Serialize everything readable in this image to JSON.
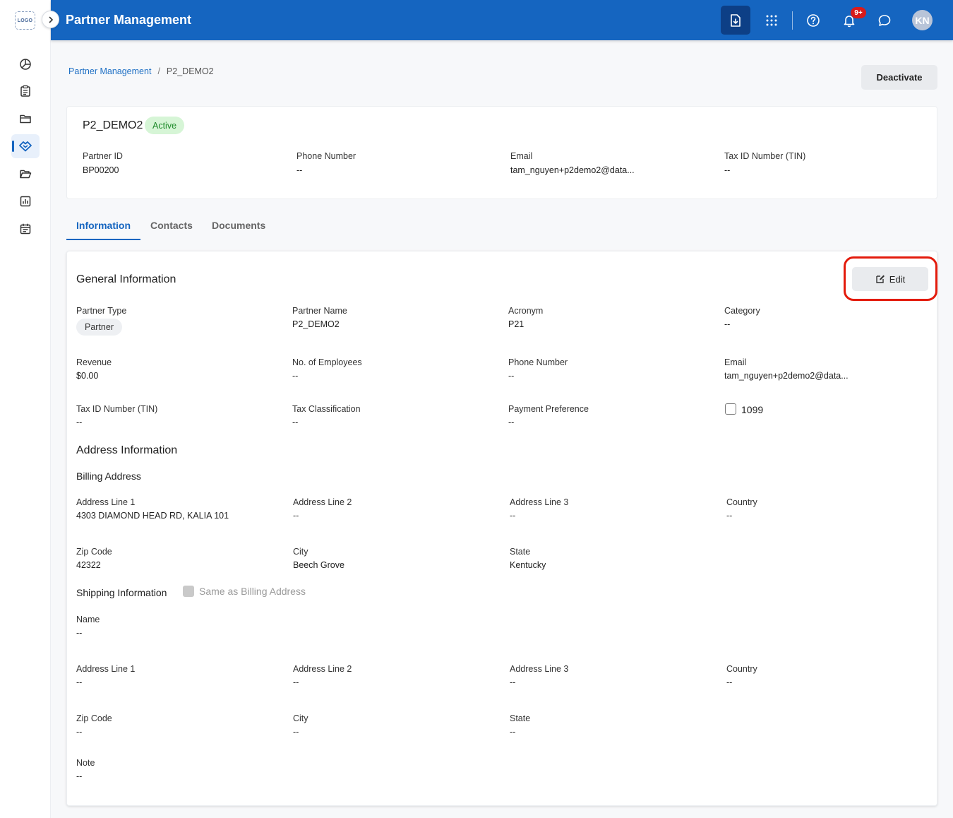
{
  "sidebar": {
    "logo_text": "LOGO",
    "items": [
      {
        "name": "dashboard",
        "icon": "pie-chart-icon"
      },
      {
        "name": "reports",
        "icon": "clipboard-icon"
      },
      {
        "name": "folder",
        "icon": "folder-icon"
      },
      {
        "name": "partners",
        "icon": "handshake-icon",
        "active": true
      },
      {
        "name": "folder-open",
        "icon": "folder-open-icon"
      },
      {
        "name": "analytics",
        "icon": "bar-chart-icon"
      },
      {
        "name": "calendar",
        "icon": "calendar-icon"
      }
    ]
  },
  "header": {
    "title": "Partner Management",
    "notification_count": "9+",
    "avatar_initials": "KN",
    "accent_color": "#1565c0"
  },
  "breadcrumb": {
    "parent": "Partner Management",
    "separator": "/",
    "current": "P2_DEMO2"
  },
  "actions": {
    "deactivate_label": "Deactivate",
    "edit_label": "Edit"
  },
  "summary": {
    "name": "P2_DEMO2",
    "status": "Active",
    "fields": [
      {
        "label": "Partner ID",
        "value": "BP00200"
      },
      {
        "label": "Phone Number",
        "value": "--"
      },
      {
        "label": "Email",
        "value": "tam_nguyen+p2demo2@data..."
      },
      {
        "label": "Tax ID Number (TIN)",
        "value": "--"
      }
    ]
  },
  "tabs": [
    {
      "label": "Information",
      "active": true
    },
    {
      "label": "Contacts"
    },
    {
      "label": "Documents"
    }
  ],
  "general": {
    "title": "General Information",
    "partner_type": {
      "label": "Partner Type",
      "value": "Partner"
    },
    "row1": [
      {
        "label": "Partner Name",
        "value": "P2_DEMO2"
      },
      {
        "label": "Acronym",
        "value": "P21"
      },
      {
        "label": "Category",
        "value": "--"
      }
    ],
    "row2": [
      {
        "label": "Revenue",
        "value": "$0.00"
      },
      {
        "label": "No. of Employees",
        "value": "--"
      },
      {
        "label": "Phone Number",
        "value": "--"
      },
      {
        "label": "Email",
        "value": "tam_nguyen+p2demo2@data..."
      }
    ],
    "row3": [
      {
        "label": "Tax ID Number (TIN)",
        "value": "--"
      },
      {
        "label": "Tax Classification",
        "value": "--"
      },
      {
        "label": "Payment Preference",
        "value": "--"
      }
    ],
    "checkbox_1099": {
      "label": "1099",
      "checked": false
    }
  },
  "address": {
    "title": "Address Information",
    "billing_title": "Billing Address",
    "billing_row1": [
      {
        "label": "Address Line 1",
        "value": "4303 DIAMOND HEAD RD, KALIA 101"
      },
      {
        "label": "Address Line 2",
        "value": "--"
      },
      {
        "label": "Address Line 3",
        "value": "--"
      },
      {
        "label": "Country",
        "value": "--"
      }
    ],
    "billing_row2": [
      {
        "label": "Zip Code",
        "value": "42322"
      },
      {
        "label": "City",
        "value": "Beech Grove"
      },
      {
        "label": "State",
        "value": "Kentucky"
      }
    ],
    "shipping_title": "Shipping Information",
    "same_as_billing": {
      "label": "Same as Billing Address",
      "checked": false,
      "disabled": true
    },
    "shipping_name": {
      "label": "Name",
      "value": "--"
    },
    "shipping_row1": [
      {
        "label": "Address Line 1",
        "value": "--"
      },
      {
        "label": "Address Line 2",
        "value": "--"
      },
      {
        "label": "Address Line 3",
        "value": "--"
      },
      {
        "label": "Country",
        "value": "--"
      }
    ],
    "shipping_row2": [
      {
        "label": "Zip Code",
        "value": "--"
      },
      {
        "label": "City",
        "value": "--"
      },
      {
        "label": "State",
        "value": "--"
      }
    ],
    "note": {
      "label": "Note",
      "value": "--"
    }
  }
}
